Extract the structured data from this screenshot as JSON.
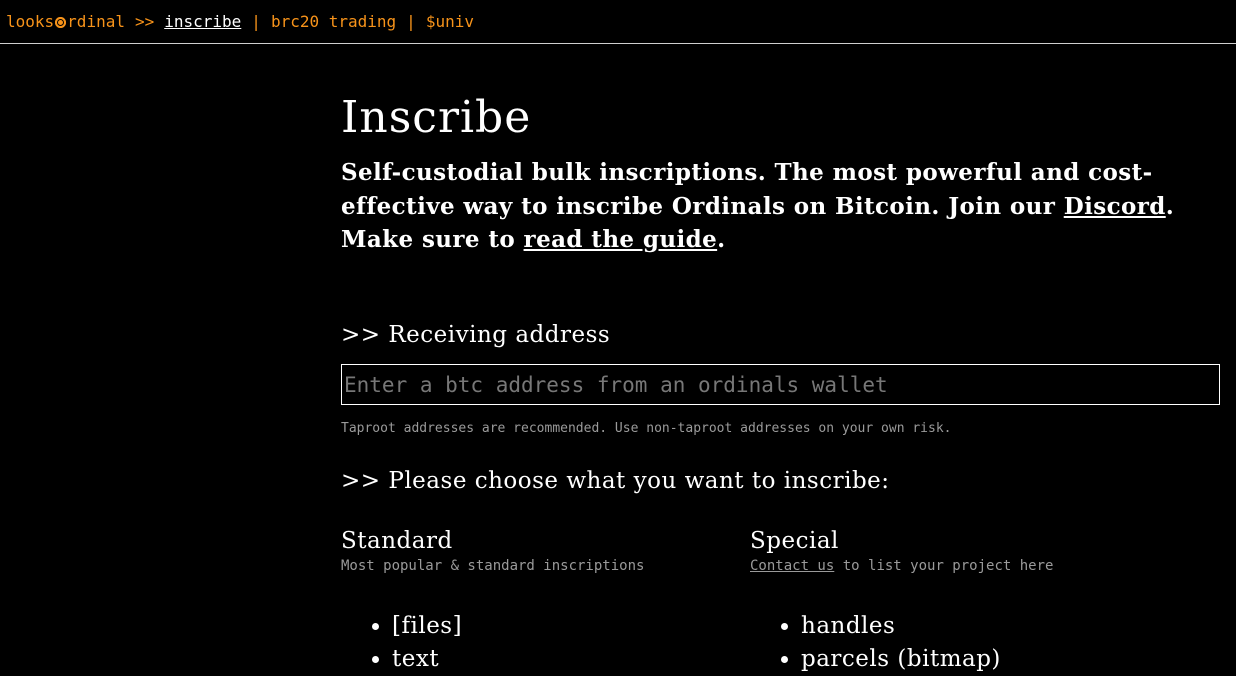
{
  "nav": {
    "brand_pre": "looks",
    "brand_post": "rdinal",
    "crumb_sep": ">>",
    "active": "inscribe",
    "divider": "|",
    "links": [
      "brc20 trading",
      "$univ"
    ]
  },
  "header": {
    "title": "Inscribe",
    "intro_text": "Self-custodial bulk inscriptions. The most powerful and cost-effective way to inscribe Ordinals on Bitcoin. Join our ",
    "discord_link": "Discord",
    "intro_mid": ". Make sure to ",
    "guide_link": "read the guide",
    "intro_end": "."
  },
  "receiving": {
    "heading": ">> Receiving address",
    "placeholder": "Enter a btc address from an ordinals wallet",
    "value": "",
    "hint": "Taproot addresses are recommended. Use non-taproot addresses on your own risk."
  },
  "choose": {
    "heading": ">> Please choose what you want to inscribe:"
  },
  "standard": {
    "title": "Standard",
    "subtitle": "Most popular & standard inscriptions",
    "items": [
      "[files]",
      "text"
    ]
  },
  "special": {
    "title": "Special",
    "contact_link": "Contact us",
    "subtitle_rest": " to list your project here",
    "items": [
      "handles",
      "parcels (bitmap)"
    ]
  },
  "colors": {
    "accent": "#f7931a",
    "background": "#000000",
    "text": "#ffffff",
    "muted": "#9a9a9a"
  }
}
